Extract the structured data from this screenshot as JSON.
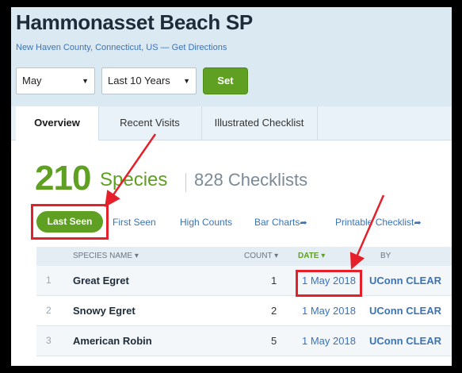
{
  "page": {
    "title": "Hammonasset Beach SP",
    "subtitle": "New Haven County, Connecticut, US — Get Directions"
  },
  "filters": {
    "month": "May",
    "range": "Last 10 Years",
    "set_label": "Set"
  },
  "tabs": [
    {
      "label": "Overview",
      "active": true
    },
    {
      "label": "Recent Visits",
      "active": false
    },
    {
      "label": "Illustrated Checklist",
      "active": false
    }
  ],
  "summary": {
    "species_count": "210",
    "species_label": "Species",
    "checklists_label": "828 Checklists"
  },
  "views": {
    "last_seen": "Last Seen",
    "first_seen": "First Seen",
    "high_counts": "High Counts",
    "bar_charts": "Bar Charts",
    "printable": "Printable Checklist"
  },
  "table": {
    "headers": {
      "species": "SPECIES NAME",
      "count": "COUNT",
      "date": "DATE",
      "by": "BY"
    },
    "rows": [
      {
        "index": "1",
        "species": "Great Egret",
        "count": "1",
        "date": "1 May 2018",
        "by": "UConn CLEAR"
      },
      {
        "index": "2",
        "species": "Snowy Egret",
        "count": "2",
        "date": "1 May 2018",
        "by": "UConn CLEAR"
      },
      {
        "index": "3",
        "species": "American Robin",
        "count": "5",
        "date": "1 May 2018",
        "by": "UConn CLEAR"
      }
    ]
  },
  "colors": {
    "accent_green": "#5f9f22",
    "link_blue": "#3a73b8",
    "annotation_red": "#e5202a"
  }
}
